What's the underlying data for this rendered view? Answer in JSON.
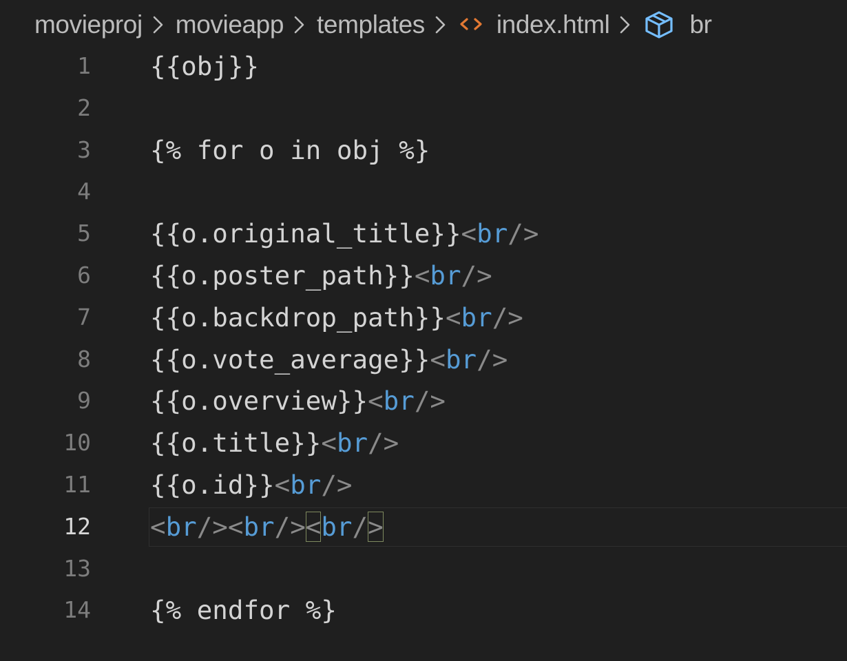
{
  "breadcrumb": {
    "items": [
      "movieproj",
      "movieapp",
      "templates",
      "index.html",
      "br"
    ],
    "file_icon": "html-file-icon",
    "symbol_icon": "symbol-element-icon"
  },
  "colors": {
    "background": "#1f1f1f",
    "text": "#d4d4d4",
    "tag": "#569cd6",
    "punctuation": "#8a8a8a",
    "line_number": "#7d7d7d",
    "html_icon": "#e37933",
    "symbol_icon": "#75beff"
  },
  "editor": {
    "current_line": 12,
    "lines": [
      {
        "n": "1",
        "tokens": [
          {
            "t": "{{obj}}",
            "k": "text"
          }
        ]
      },
      {
        "n": "2",
        "tokens": []
      },
      {
        "n": "3",
        "tokens": [
          {
            "t": "{% for o in obj %}",
            "k": "text"
          }
        ]
      },
      {
        "n": "4",
        "tokens": []
      },
      {
        "n": "5",
        "tokens": [
          {
            "t": "{{o.original_title}}",
            "k": "text"
          },
          {
            "t": "<",
            "k": "punct"
          },
          {
            "t": "br",
            "k": "tag"
          },
          {
            "t": "/>",
            "k": "punct"
          }
        ]
      },
      {
        "n": "6",
        "tokens": [
          {
            "t": "{{o.poster_path}}",
            "k": "text"
          },
          {
            "t": "<",
            "k": "punct"
          },
          {
            "t": "br",
            "k": "tag"
          },
          {
            "t": "/>",
            "k": "punct"
          }
        ]
      },
      {
        "n": "7",
        "tokens": [
          {
            "t": "{{o.backdrop_path}}",
            "k": "text"
          },
          {
            "t": "<",
            "k": "punct"
          },
          {
            "t": "br",
            "k": "tag"
          },
          {
            "t": "/>",
            "k": "punct"
          }
        ]
      },
      {
        "n": "8",
        "tokens": [
          {
            "t": "{{o.vote_average}}",
            "k": "text"
          },
          {
            "t": "<",
            "k": "punct"
          },
          {
            "t": "br",
            "k": "tag"
          },
          {
            "t": "/>",
            "k": "punct"
          }
        ]
      },
      {
        "n": "9",
        "tokens": [
          {
            "t": "{{o.overview}}",
            "k": "text"
          },
          {
            "t": "<",
            "k": "punct"
          },
          {
            "t": "br",
            "k": "tag"
          },
          {
            "t": "/>",
            "k": "punct"
          }
        ]
      },
      {
        "n": "10",
        "tokens": [
          {
            "t": "{{o.title}}",
            "k": "text"
          },
          {
            "t": "<",
            "k": "punct"
          },
          {
            "t": "br",
            "k": "tag"
          },
          {
            "t": "/>",
            "k": "punct"
          }
        ]
      },
      {
        "n": "11",
        "tokens": [
          {
            "t": "{{o.id}}",
            "k": "text"
          },
          {
            "t": "<",
            "k": "punct"
          },
          {
            "t": "br",
            "k": "tag"
          },
          {
            "t": "/>",
            "k": "punct"
          }
        ]
      },
      {
        "n": "12",
        "tokens": [
          {
            "t": "<",
            "k": "punct"
          },
          {
            "t": "br",
            "k": "tag"
          },
          {
            "t": "/>",
            "k": "punct"
          },
          {
            "t": "<",
            "k": "punct"
          },
          {
            "t": "br",
            "k": "tag"
          },
          {
            "t": "/>",
            "k": "punct"
          },
          {
            "t": "<",
            "k": "punct",
            "hl": true
          },
          {
            "t": "br",
            "k": "tag"
          },
          {
            "t": "/",
            "k": "punct"
          },
          {
            "t": ">",
            "k": "punct",
            "hl": true
          }
        ]
      },
      {
        "n": "13",
        "tokens": []
      },
      {
        "n": "14",
        "tokens": [
          {
            "t": "{% endfor %}",
            "k": "text"
          }
        ]
      }
    ]
  }
}
